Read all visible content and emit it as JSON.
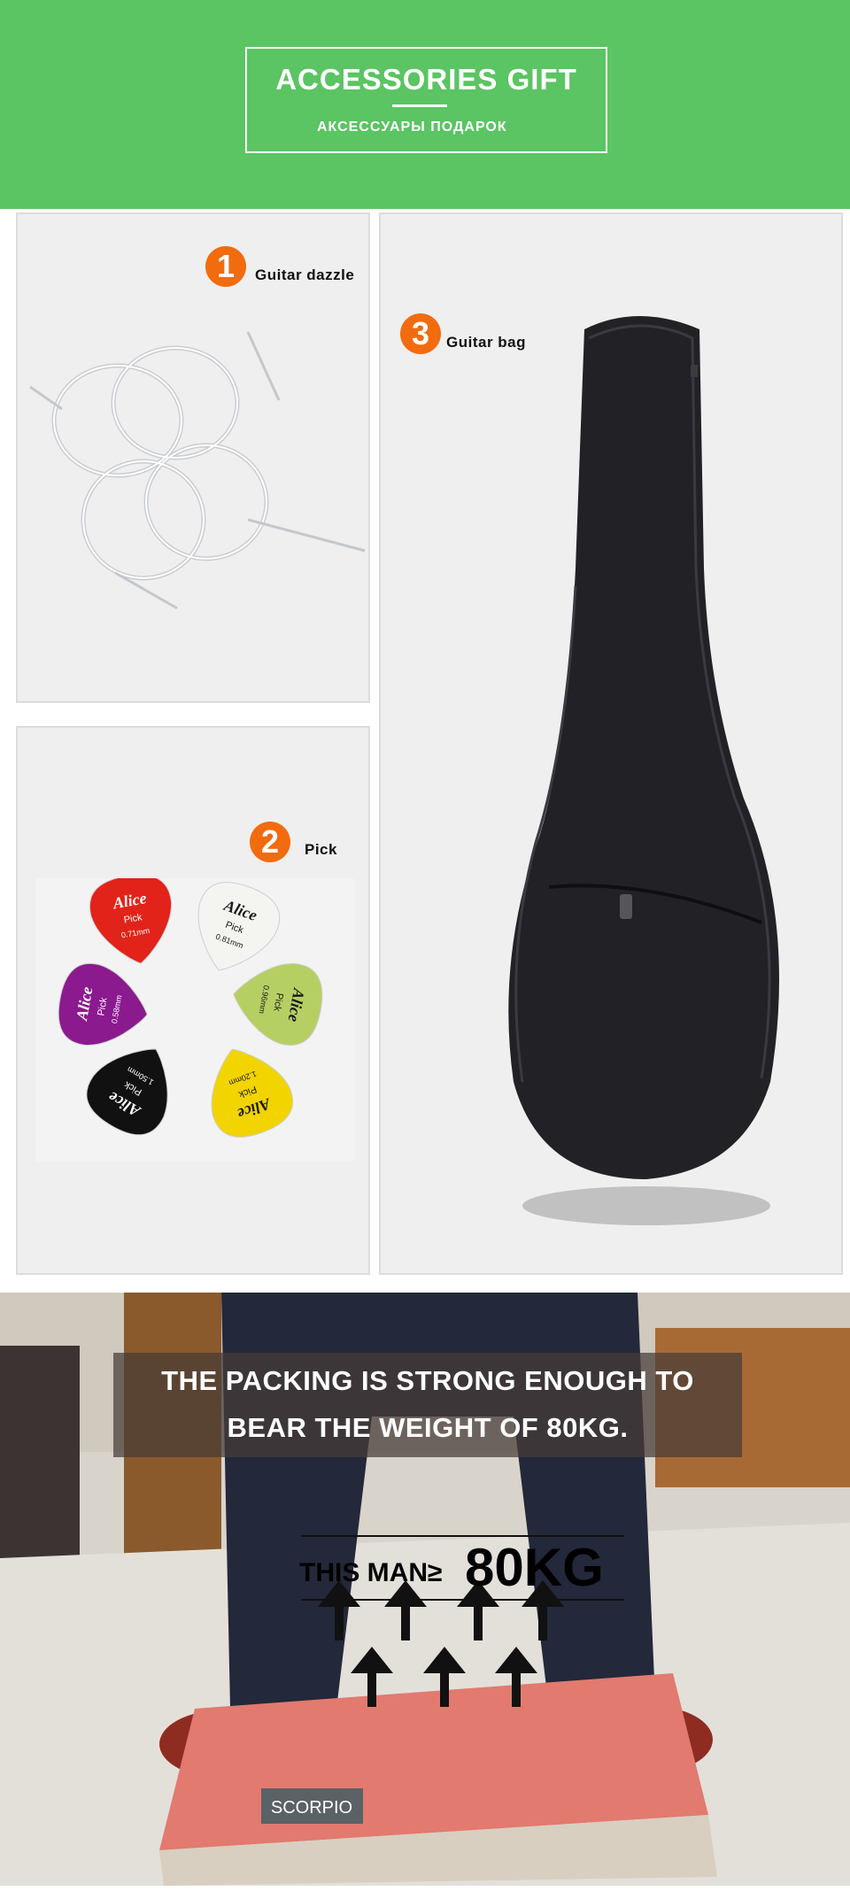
{
  "header": {
    "title": "ACCESSORIES GIFT",
    "subtitle": "АКСЕССУАРЫ ПОДАРОК"
  },
  "items": [
    {
      "number": "1",
      "label": "Guitar dazzle"
    },
    {
      "number": "2",
      "label": "Pick"
    },
    {
      "number": "3",
      "label": "Guitar bag"
    }
  ],
  "picks": [
    {
      "brand": "Alice",
      "text": "Pick",
      "thickness": "0.71mm",
      "color": "#e2231a"
    },
    {
      "brand": "Alice",
      "text": "Pick",
      "thickness": "0.81mm",
      "color": "#f4f4f0"
    },
    {
      "brand": "Alice",
      "text": "Pick",
      "thickness": "0.58mm",
      "color": "#8b1a8f"
    },
    {
      "brand": "Alice",
      "text": "Pick",
      "thickness": "0.96mm",
      "color": "#b6cf63"
    },
    {
      "brand": "Alice",
      "text": "Pick",
      "thickness": "1.50mm",
      "color": "#111111"
    },
    {
      "brand": "Alice",
      "text": "Pick",
      "thickness": "1.20mm",
      "color": "#f1d400"
    }
  ],
  "packing": {
    "line1": "THE PACKING IS STRONG ENOUGH TO",
    "line2": "BEAR THE WEIGHT OF 80KG.",
    "man_label": "THIS MAN≥",
    "man_weight": "80KG",
    "box_brand": "SCORPIO"
  },
  "colors": {
    "header_green": "#5bc463",
    "badge_orange": "#f26b0f"
  }
}
